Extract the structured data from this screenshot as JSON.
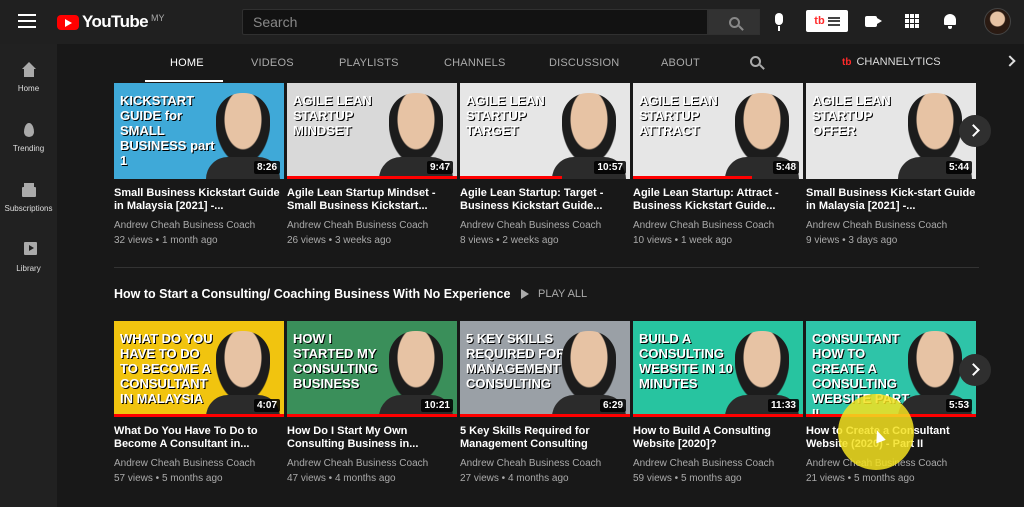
{
  "topbar": {
    "logo_text": "YouTube",
    "country": "MY",
    "search_placeholder": "Search",
    "extension_label": "tb"
  },
  "sidebar": {
    "items": [
      {
        "label": "Home"
      },
      {
        "label": "Trending"
      },
      {
        "label": "Subscriptions"
      },
      {
        "label": "Library"
      }
    ]
  },
  "tabs": {
    "items": [
      "HOME",
      "VIDEOS",
      "PLAYLISTS",
      "CHANNELS",
      "DISCUSSION",
      "ABOUT"
    ],
    "active": "HOME",
    "channelytics_label": "CHANNELYTICS",
    "channelytics_badge": "tb"
  },
  "shelf1": {
    "videos": [
      {
        "title": "Small Business Kickstart Guide in Malaysia [2021] -...",
        "channel": "Andrew Cheah Business Coach",
        "views": "32 views",
        "age": "1 month ago",
        "duration": "8:26",
        "thumb_text": "KICKSTART GUIDE for SMALL BUSINESS part 1",
        "thumb_bg": "#3fa9d8",
        "progress_fraction": 0
      },
      {
        "title": "Agile Lean Startup Mindset - Small Business Kickstart...",
        "channel": "Andrew Cheah Business Coach",
        "views": "26 views",
        "age": "3 weeks ago",
        "duration": "9:47",
        "thumb_text": "AGILE LEAN STARTUP MINDSET",
        "thumb_bg": "#d9d9d9",
        "progress_fraction": 1
      },
      {
        "title": "Agile Lean Startup: Target - Business Kickstart Guide...",
        "channel": "Andrew Cheah Business Coach",
        "views": "8 views",
        "age": "2 weeks ago",
        "duration": "10:57",
        "thumb_text": "AGILE LEAN STARTUP TARGET",
        "thumb_bg": "#e6e6e6",
        "progress_fraction": 0.6
      },
      {
        "title": "Agile Lean Startup: Attract - Business Kickstart Guide...",
        "channel": "Andrew Cheah Business Coach",
        "views": "10 views",
        "age": "1 week ago",
        "duration": "5:48",
        "thumb_text": "AGILE LEAN STARTUP ATTRACT",
        "thumb_bg": "#e6e6e6",
        "progress_fraction": 0.7
      },
      {
        "title": "Small Business Kick-start Guide in Malaysia [2021] -...",
        "channel": "Andrew Cheah Business Coach",
        "views": "9 views",
        "age": "3 days ago",
        "duration": "5:44",
        "thumb_text": "AGILE LEAN STARTUP OFFER",
        "thumb_bg": "#e6e6e6",
        "progress_fraction": 0
      }
    ]
  },
  "shelf2": {
    "title": "How to Start a Consulting/ Coaching Business With No Experience",
    "play_all_label": "PLAY ALL",
    "videos": [
      {
        "title": "What Do You Have To Do to Become A Consultant in...",
        "channel": "Andrew Cheah Business Coach",
        "views": "57 views",
        "age": "5 months ago",
        "duration": "4:07",
        "thumb_text": "WHAT DO YOU HAVE TO DO TO BECOME A CONSULTANT IN MALAYSIA",
        "thumb_bg": "#f1c40f",
        "progress_fraction": 1
      },
      {
        "title": "How Do I Start My Own Consulting Business in...",
        "channel": "Andrew Cheah Business Coach",
        "views": "47 views",
        "age": "4 months ago",
        "duration": "10:21",
        "thumb_text": "HOW I STARTED MY CONSULTING BUSINESS",
        "thumb_bg": "#3a8f5a",
        "progress_fraction": 1
      },
      {
        "title": "5 Key Skills Required for Management Consulting",
        "channel": "Andrew Cheah Business Coach",
        "views": "27 views",
        "age": "4 months ago",
        "duration": "6:29",
        "thumb_text": "5 KEY SKILLS REQUIRED FOR MANAGEMENT CONSULTING",
        "thumb_bg": "#9aa0a6",
        "progress_fraction": 1
      },
      {
        "title": "How to Build A Consulting Website [2020]?",
        "channel": "Andrew Cheah Business Coach",
        "views": "59 views",
        "age": "5 months ago",
        "duration": "11:33",
        "thumb_text": "BUILD A CONSULTING WEBSITE IN 10 MINUTES",
        "thumb_bg": "#27c4a0",
        "progress_fraction": 1
      },
      {
        "title": "How to Create a Consultant Website (2020) - Part II",
        "channel": "Andrew Cheah Business Coach",
        "views": "21 views",
        "age": "5 months ago",
        "duration": "5:53",
        "thumb_text": "CONSULTANT HOW TO CREATE A CONSULTING WEBSITE PART II",
        "thumb_bg": "#2ec4a8",
        "progress_fraction": 1
      }
    ]
  }
}
